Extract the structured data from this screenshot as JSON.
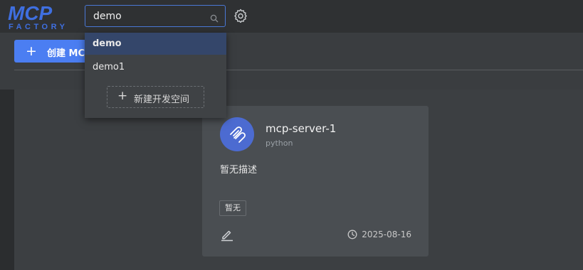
{
  "header": {
    "logo_text": "MCP FACTORY",
    "search": {
      "value": "demo"
    }
  },
  "toolbar": {
    "create_label": "创建 MCP"
  },
  "dropdown": {
    "options": [
      {
        "label": "demo",
        "selected": true
      },
      {
        "label": "demo1",
        "selected": false
      }
    ],
    "new_space_label": "新建开发空间"
  },
  "card": {
    "name": "mcp-server-1",
    "language": "python",
    "description": "暂无描述",
    "tag": "暂无",
    "date": "2025-08-16"
  },
  "colors": {
    "accent": "#4b7ef2",
    "logo": "#3f6fe0",
    "avatar": "#4c6bd1"
  },
  "icons": [
    "search-icon",
    "gear-icon",
    "plus-icon",
    "server-icon",
    "edit-icon",
    "clock-icon"
  ]
}
